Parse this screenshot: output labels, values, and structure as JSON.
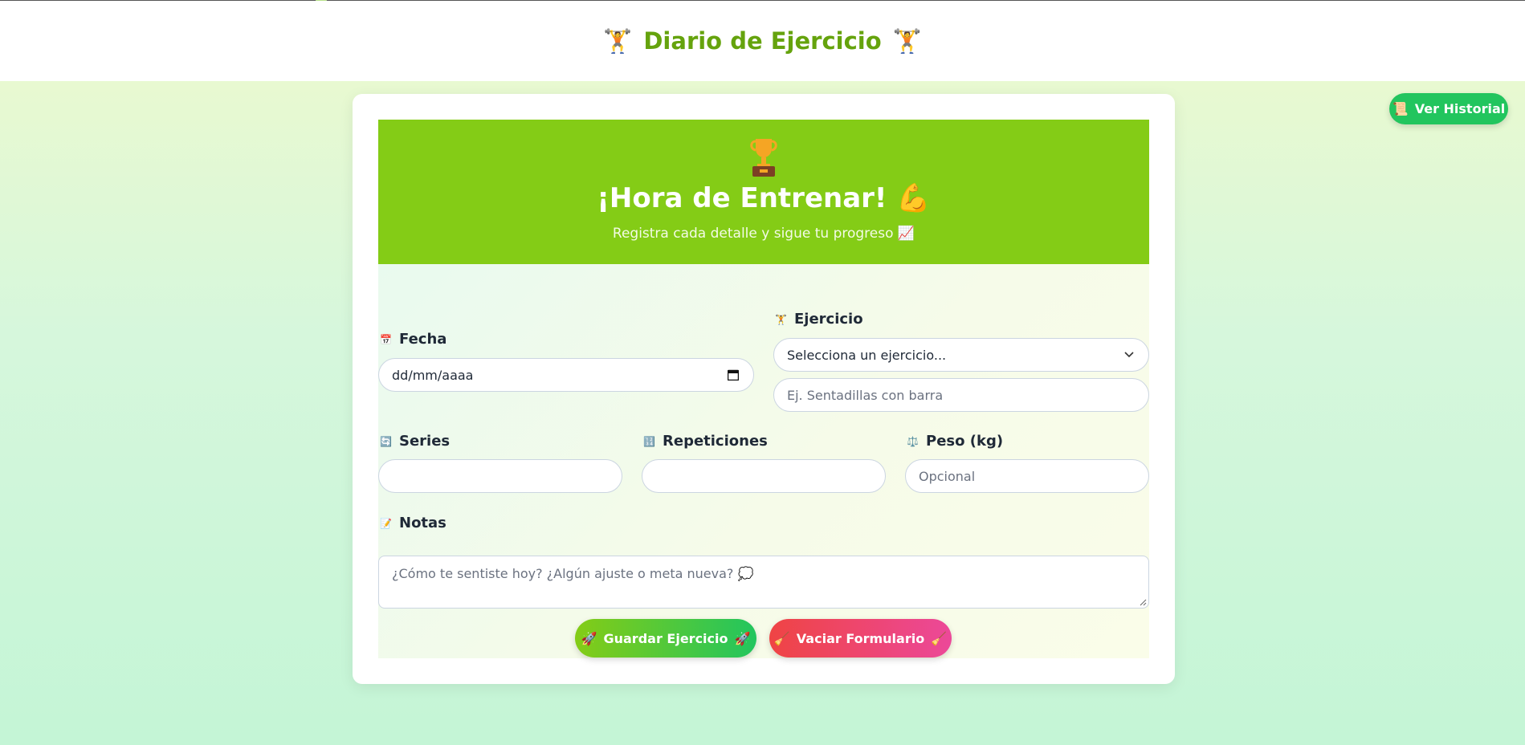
{
  "header": {
    "title": "Diario de Ejercicio",
    "icon_left": "🏋️",
    "icon_right": "🏋️"
  },
  "history_button": {
    "icon": "📜",
    "label": "Ver Historial"
  },
  "hero": {
    "trophy_icon": "trophy-icon",
    "title": "¡Hora de Entrenar! 💪",
    "subtitle": "Registra cada detalle y sigue tu progreso 📈"
  },
  "form": {
    "date": {
      "icon": "📅",
      "label": "Fecha",
      "value": "dd/mm/aaaa"
    },
    "exercise": {
      "icon": "🏋️",
      "label": "Ejercicio",
      "select_value": "Selecciona un ejercicio...",
      "custom_placeholder": "Ej. Sentadillas con barra"
    },
    "series": {
      "icon": "🔄",
      "label": "Series",
      "value": ""
    },
    "reps": {
      "icon": "🔢",
      "label": "Repeticiones",
      "value": ""
    },
    "weight": {
      "icon": "⚖️",
      "label": "Peso (kg)",
      "placeholder": "Opcional"
    },
    "notes": {
      "icon": "📝",
      "label": "Notas",
      "placeholder": "¿Cómo te sentiste hoy? ¿Algún ajuste o meta nueva? 💭"
    }
  },
  "actions": {
    "save": {
      "icon_left": "🚀",
      "label": "Guardar Ejercicio",
      "icon_right": "🚀"
    },
    "clear": {
      "icon_left": "🧹",
      "label": "Vaciar Formulario",
      "icon_right": "🧹"
    }
  },
  "colors": {
    "accent_green": "#84cc16",
    "title_green": "#65a30d",
    "save_green": "#22c55e",
    "clear_red": "#ef4444",
    "clear_pink": "#ec4899"
  }
}
